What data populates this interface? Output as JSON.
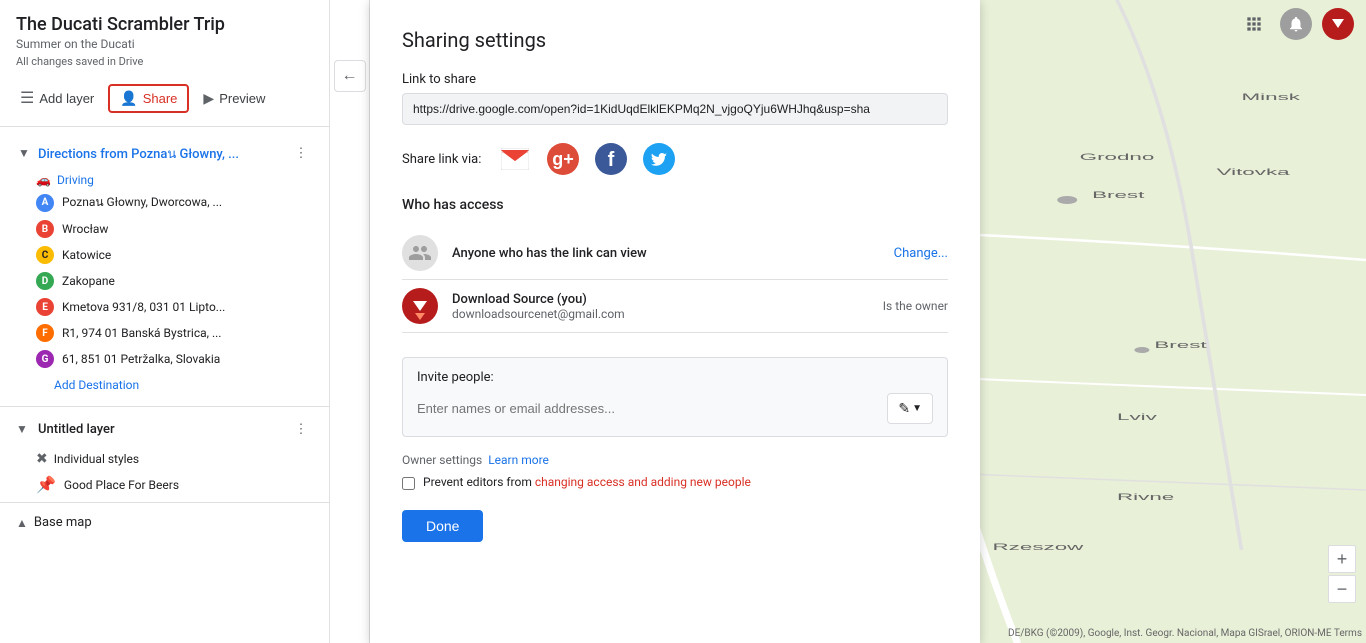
{
  "app": {
    "title": "The Ducati Scrambler Trip",
    "subtitle": "Summer on the Ducati",
    "saved_status": "All changes saved in Drive"
  },
  "toolbar": {
    "add_layer": "Add layer",
    "share": "Share",
    "preview": "Preview"
  },
  "layer": {
    "title": "Directions from Poznaน Głowny, ...",
    "route_type": "Driving",
    "waypoints": [
      {
        "label": "A",
        "text": "Poznaน Głowny, Dworcowa, ..."
      },
      {
        "label": "B",
        "text": "Wrocław"
      },
      {
        "label": "C",
        "text": "Katowice"
      },
      {
        "label": "D",
        "text": "Zakopane"
      },
      {
        "label": "E",
        "text": "Kmetova 931/8, 031 01 Lipto..."
      },
      {
        "label": "F",
        "text": "R1, 974 01 Banská Bystrica, ..."
      },
      {
        "label": "G",
        "text": "61, 851 01 Petržalka, Slovakia"
      }
    ],
    "add_destination": "Add Destination"
  },
  "untitled_layer": {
    "title": "Untitled layer",
    "individual_styles": "Individual styles",
    "place": "Good Place For Beers"
  },
  "base_map": {
    "label": "Base map"
  },
  "sharing": {
    "title": "Sharing settings",
    "link_label": "Link to share",
    "link_url": "https://drive.google.com/open?id=1KidUqdElklEKPMq2N_vjgoQYju6WHJhq&usp=sha",
    "share_via_label": "Share link via:",
    "who_access": "Who has access",
    "anyone_access": "Anyone who has the link can view",
    "change_link": "Change...",
    "user_name": "Download Source (you)",
    "user_email": "downloadsourcenet@gmail.com",
    "user_role": "Is the owner",
    "invite_label": "Invite people:",
    "invite_placeholder": "Enter names or email addresses...",
    "owner_settings_label": "Owner settings",
    "learn_more": "Learn more",
    "prevent_label": "Prevent editors from changing access and adding new people",
    "done_button": "Done"
  },
  "map": {
    "zoom_in": "+",
    "zoom_out": "−",
    "attribution": "DE/BKG (©2009), Google, Inst. Geogr. Nacional, Mapa GISrael, ORION-ME   Terms"
  }
}
